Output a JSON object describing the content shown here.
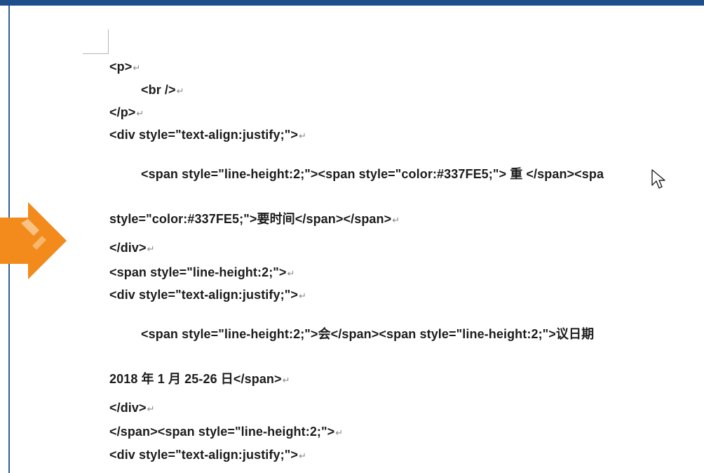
{
  "document": {
    "lines": [
      {
        "text": "<p>",
        "indent": 0
      },
      {
        "text": "<br />",
        "indent": 1
      },
      {
        "text": "</p>",
        "indent": 0
      },
      {
        "text": "<div style=\"text-align:justify;\">",
        "indent": 0
      },
      {
        "text": "<span  style=\"line-height:2;\"><span  style=\"color:#337FE5;\"> 重 </span><spa",
        "indent": 1
      },
      {
        "text": "style=\"color:#337FE5;\">要时间</span></span>",
        "indent": 0
      },
      {
        "text": "</div>",
        "indent": 0
      },
      {
        "text": "<span style=\"line-height:2;\">",
        "indent": 0
      },
      {
        "text": "<div style=\"text-align:justify;\">",
        "indent": 0
      },
      {
        "text": "<span  style=\"line-height:2;\">会</span><span  style=\"line-height:2;\">议日期",
        "indent": 1
      },
      {
        "text": "2018 年 1 月 25-26 日</span>",
        "indent": 0
      },
      {
        "text": "</div>",
        "indent": 0
      },
      {
        "text": "</span><span style=\"line-height:2;\">",
        "indent": 0
      },
      {
        "text": "<div style=\"text-align:justify;\">",
        "indent": 0
      }
    ],
    "paragraph_mark": "↵"
  },
  "colors": {
    "frame": "#1f4e8c",
    "arrow": "#f28a1c",
    "text": "#1c1c1c",
    "spell_underline": "#e03030",
    "grammar_underline": "#3050d0"
  },
  "icons": {
    "arrow": "orange-right-arrow-icon",
    "cursor": "mouse-pointer-icon"
  }
}
